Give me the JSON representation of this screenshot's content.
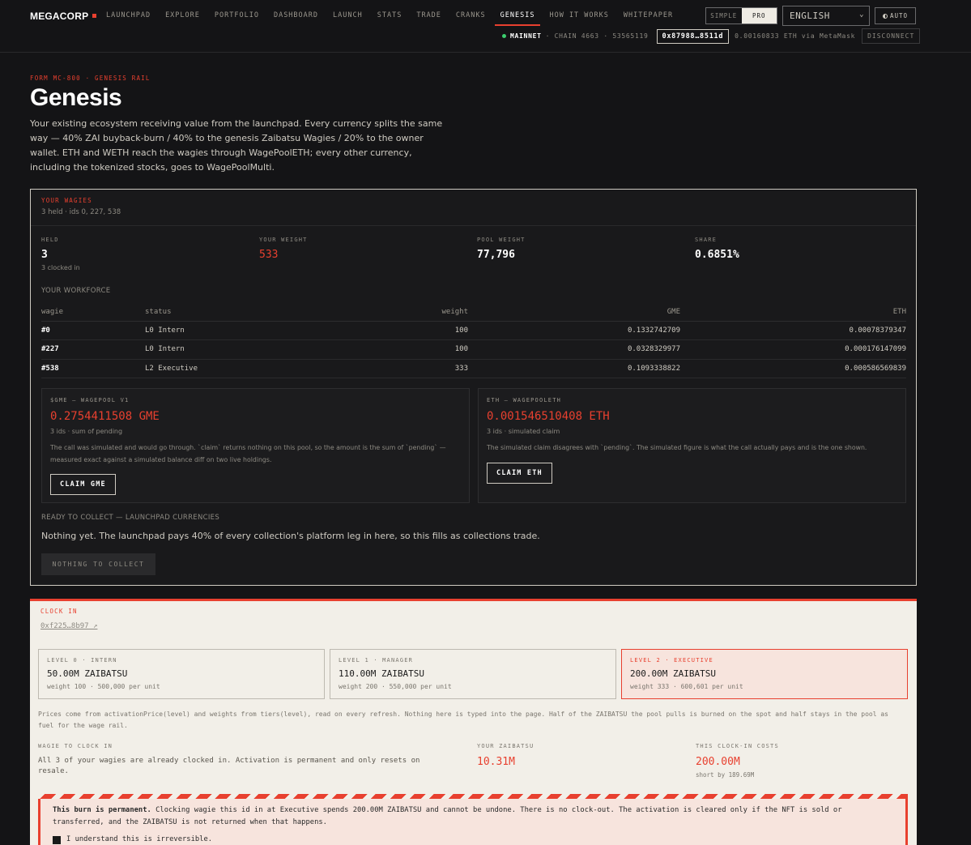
{
  "brand": {
    "name": "MEGACORP"
  },
  "nav": {
    "items": [
      "LAUNCHPAD",
      "EXPLORE",
      "PORTFOLIO",
      "DASHBOARD",
      "LAUNCH",
      "STATS",
      "TRADE",
      "CRANKS",
      "GENESIS",
      "HOW IT WORKS",
      "WHITEPAPER"
    ],
    "active": "GENESIS"
  },
  "mode": {
    "simple": "SIMPLE",
    "pro": "PRO",
    "selected": "PRO"
  },
  "language": {
    "value": "ENGLISH"
  },
  "theme": {
    "label": "AUTO"
  },
  "network": {
    "name": "MAINNET",
    "chain": "· CHAIN 4663 · 53565119",
    "address": "0x87988…8511d",
    "balance": "0.00160833 ETH via MetaMask",
    "disconnect": "DISCONNECT"
  },
  "header": {
    "form_tag": "FORM MC-800 · GENESIS RAIL",
    "title": "Genesis",
    "intro": "Your existing ecosystem receiving value from the launchpad. Every currency splits the same way — 40% ZAI buyback-burn / 40% to the genesis Zaibatsu Wagies / 20% to the owner wallet. ETH and WETH reach the wagies through WagePoolETH; every other currency, including the tokenized stocks, goes to WagePoolMulti."
  },
  "wagies": {
    "label": "YOUR WAGIES",
    "held_summary": "3 held · ids 0, 227, 538",
    "stats": {
      "held_label": "HELD",
      "held_value": "3",
      "held_sub": "3 clocked in",
      "weight_label": "YOUR WEIGHT",
      "weight_value": "533",
      "pool_label": "POOL WEIGHT",
      "pool_value": "77,796",
      "share_label": "SHARE",
      "share_value": "0.6851%"
    },
    "workforce_label": "YOUR WORKFORCE",
    "table": {
      "headers": [
        "wagie",
        "status",
        "weight",
        "GME",
        "ETH"
      ],
      "rows": [
        [
          "#0",
          "L0 Intern",
          "100",
          "0.1332742709",
          "0.00078379347"
        ],
        [
          "#227",
          "L0 Intern",
          "100",
          "0.0328329977",
          "0.000176147099"
        ],
        [
          "#538",
          "L2 Executive",
          "333",
          "0.1093338822",
          "0.000586569839"
        ]
      ]
    },
    "pool_gme": {
      "title": "$GME — WAGEPOOL V1",
      "amount": "0.2754411508 GME",
      "sub": "3 ids · sum of pending",
      "desc": "The call was simulated and would go through. `claim` returns nothing on this pool, so the amount is the sum of `pending` — measured exact against a simulated balance diff on two live holdings.",
      "button": "CLAIM GME"
    },
    "pool_eth": {
      "title": "ETH — WAGEPOOLETH",
      "amount": "0.001546510408 ETH",
      "sub": "3 ids · simulated claim",
      "desc": "The simulated claim disagrees with `pending`. The simulated figure is what the call actually pays and is the one shown.",
      "button": "CLAIM ETH"
    },
    "ready_label": "READY TO COLLECT — LAUNCHPAD CURRENCIES",
    "ready_text": "Nothing yet. The launchpad pays 40% of every collection's platform leg in here, so this fills as collections trade.",
    "collect_button": "NOTHING TO COLLECT"
  },
  "clock_in": {
    "label": "CLOCK IN",
    "contract_link": "0xf225…8b97 ↗",
    "levels": [
      {
        "title": "LEVEL 0 · INTERN",
        "price": "50.00M ZAIBATSU",
        "detail": "weight 100 · 500,000 per unit",
        "selected": false
      },
      {
        "title": "LEVEL 1 · MANAGER",
        "price": "110.00M ZAIBATSU",
        "detail": "weight 200 · 550,000 per unit",
        "selected": false
      },
      {
        "title": "LEVEL 2 · EXECUTIVE",
        "price": "200.00M ZAIBATSU",
        "detail": "weight 333 · 600,601 per unit",
        "selected": true
      }
    ],
    "prices_note": "Prices come from activationPrice(level) and weights from tiers(level), read on every refresh. Nothing here is typed into the page. Half of the ZAIBATSU the pool pulls is burned on the spot and half stays in the pool as fuel for the wage rail.",
    "wagie_label": "WAGIE TO CLOCK IN",
    "wagie_text": "All 3 of your wagies are already clocked in. Activation is permanent and only resets on resale.",
    "balance_label": "YOUR ZAIBATSU",
    "balance_value": "10.31M",
    "cost_label": "THIS CLOCK-IN COSTS",
    "cost_value": "200.00M",
    "cost_sub": "short by 189.69M",
    "warning_bold": "This burn is permanent.",
    "warning_text": " Clocking wagie this id in at Executive spends 200.00M ZAIBATSU and cannot be undone. There is no clock-out. The activation is cleared only if the NFT is sold or transferred, and the ZAIBATSU is not returned when that happens.",
    "confirm_label": "I understand this is irreversible."
  },
  "colors": {
    "accent": "#e8402f",
    "bg": "#141416",
    "light_panel": "#f2efe8"
  }
}
